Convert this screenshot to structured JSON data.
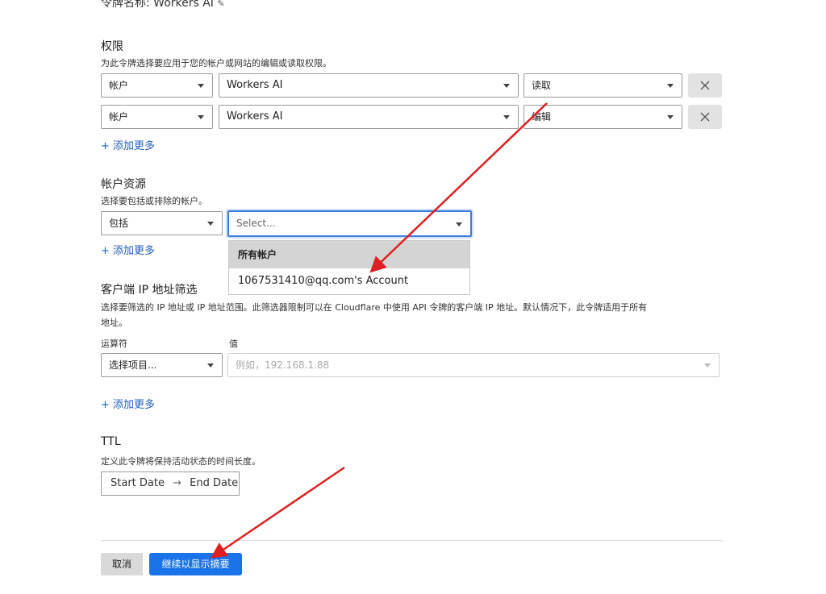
{
  "token": {
    "name_label": "令牌名称: Workers AI"
  },
  "permissions": {
    "title": "权限",
    "description": "为此令牌选择要应用于您的帐户或网站的编辑或读取权限。",
    "rows": [
      {
        "scope": "帐户",
        "resource": "Workers AI",
        "access": "读取"
      },
      {
        "scope": "帐户",
        "resource": "Workers AI",
        "access": "编辑"
      }
    ],
    "add_more": "+ 添加更多"
  },
  "account_resources": {
    "title": "帐户资源",
    "description": "选择要包括或排除的帐户。",
    "mode": "包括",
    "select_placeholder": "Select...",
    "add_more": "+ 添加更多",
    "dropdown": {
      "header": "所有帐户",
      "options": [
        "1067531410@qq.com's Account"
      ]
    }
  },
  "ip_filter": {
    "title": "客户端 IP 地址筛选",
    "description_line1": "选择要筛选的 IP 地址或 IP 地址范围。此筛选器限制可以在 Cloudflare 中使用 API 令牌的客户端 IP 地址。默认情况下，此令牌适用于所有",
    "description_line2": "地址。",
    "operator_label": "运算符",
    "value_label": "值",
    "operator_placeholder": "选择项目...",
    "value_placeholder": "例如，192.168.1.88",
    "add_more": "+ 添加更多"
  },
  "ttl": {
    "title": "TTL",
    "description": "定义此令牌将保持活动状态的时间长度。",
    "start_date": "Start Date",
    "arrow": "→",
    "end_date": "End Date"
  },
  "actions": {
    "cancel": "取消",
    "continue": "继续以显示摘要"
  },
  "annotation": {
    "arrow_color": "#e02020"
  }
}
